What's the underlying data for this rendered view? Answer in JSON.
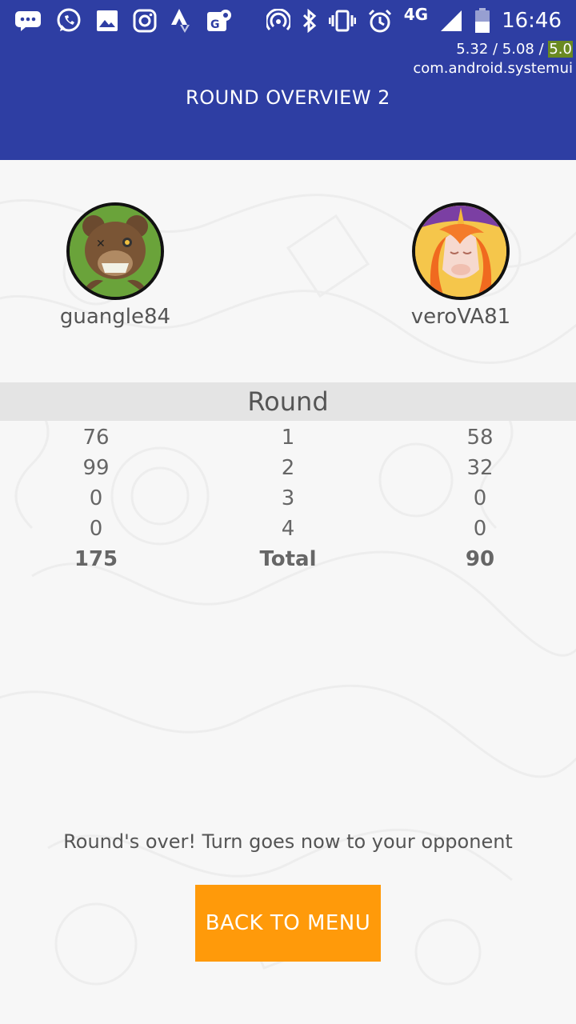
{
  "status_bar": {
    "network": "4G",
    "time": "16:46"
  },
  "debug_overlay": {
    "cpu_a": "5.32 / 5.08 / ",
    "cpu_b": "5.0",
    "process": "com.android.systemui"
  },
  "header": {
    "title": "ROUND OVERVIEW 2"
  },
  "players": [
    {
      "name": "guangle84",
      "avatar_icon": "bear-avatar-icon"
    },
    {
      "name": "veroVA81",
      "avatar_icon": "unicorn-avatar-icon"
    }
  ],
  "round_table": {
    "heading": "Round",
    "rows": [
      {
        "left": "76",
        "round": "1",
        "right": "58"
      },
      {
        "left": "99",
        "round": "2",
        "right": "32"
      },
      {
        "left": "0",
        "round": "3",
        "right": "0"
      },
      {
        "left": "0",
        "round": "4",
        "right": "0"
      }
    ],
    "total": {
      "left": "175",
      "label": "Total",
      "right": "90"
    }
  },
  "message": "Round's over! Turn goes now to your opponent",
  "button": {
    "label": "BACK TO MENU"
  },
  "colors": {
    "app_bar": "#2e3ea3",
    "button": "#ff9a0a",
    "round_header": "#e4e4e4"
  }
}
